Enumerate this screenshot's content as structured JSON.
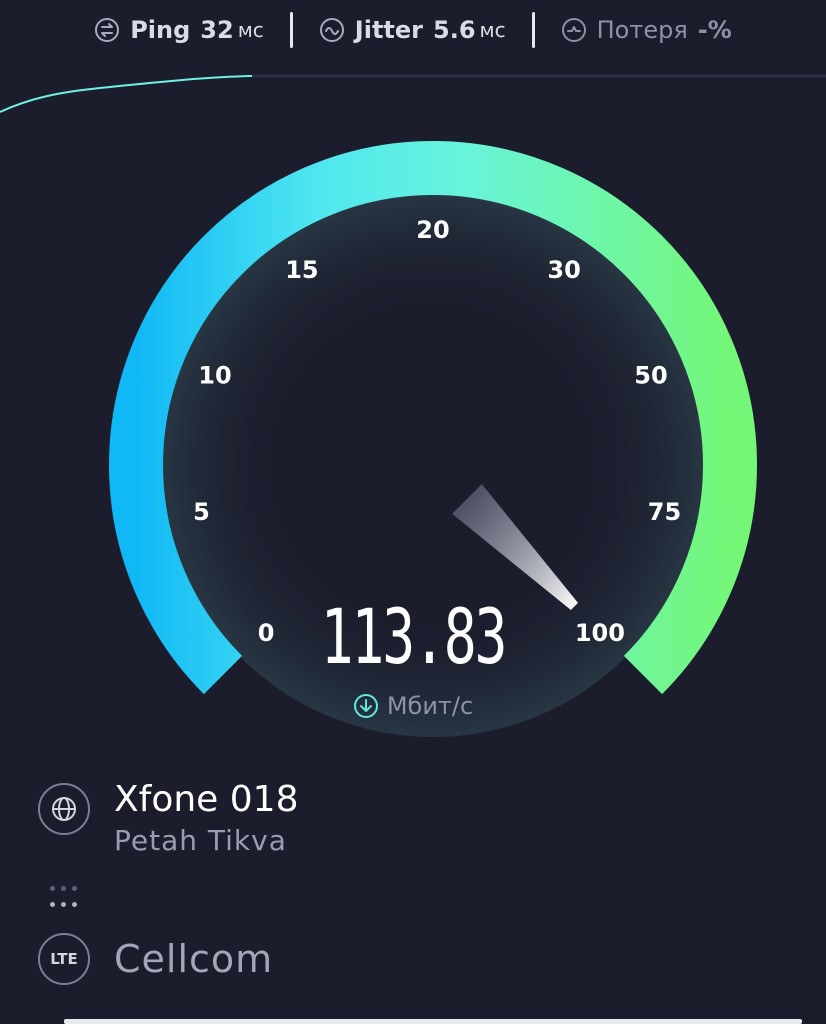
{
  "stats": {
    "ping": {
      "label": "Ping",
      "value": "32",
      "unit": "мс"
    },
    "jitter": {
      "label": "Jitter",
      "value": "5.6",
      "unit": "мс"
    },
    "loss": {
      "label": "Потеря",
      "value": "-%"
    }
  },
  "gauge": {
    "ticks": [
      "0",
      "5",
      "10",
      "15",
      "20",
      "30",
      "50",
      "75",
      "100"
    ],
    "speed": "113.83",
    "unit": "Мбит/с",
    "needle_value": 100,
    "arc_colors": [
      "#10b8f5",
      "#5ef1e8",
      "#6ff7a0",
      "#74f777"
    ]
  },
  "server": {
    "name": "Xfone 018",
    "city": "Petah Tikva",
    "icon": "globe-icon"
  },
  "provider": {
    "badge": "LTE",
    "name": "Cellcom"
  }
}
